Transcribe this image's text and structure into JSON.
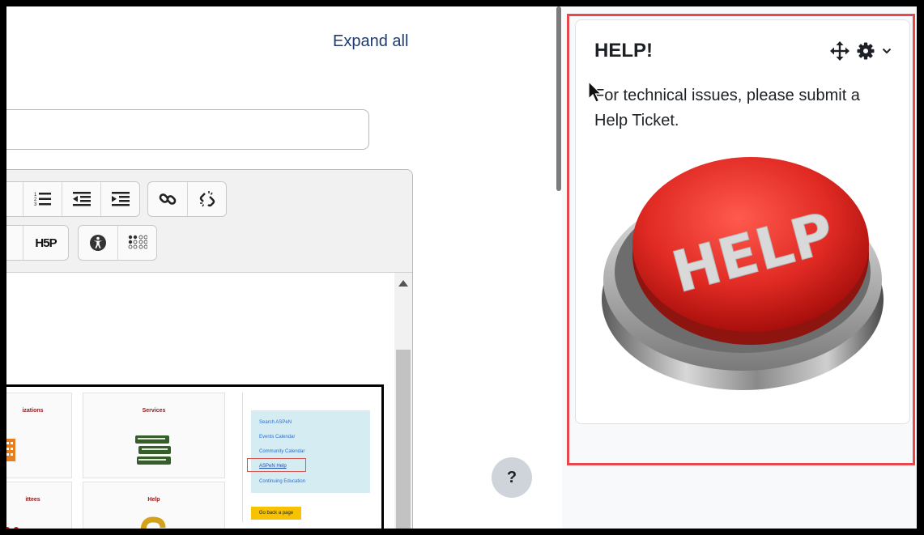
{
  "left_pane": {
    "expand_all": "Expand all",
    "embedded_screenshot": {
      "cards": [
        "izations",
        "Services",
        "ittees",
        "Help"
      ],
      "links": [
        "Search ASPeN",
        "Events Calendar",
        "Community Calendar",
        "ASPeN Help",
        "Continuing Education"
      ],
      "go_back": "Go back a page"
    },
    "toolbar": {
      "h5p_label": "H5P"
    },
    "help_fab": "?"
  },
  "help_block": {
    "title": "HELP!",
    "text": "For technical issues, please submit a Help Ticket.",
    "image_text": "HELP",
    "controls": [
      "move-icon",
      "gear-icon",
      "chevron-down-icon"
    ]
  },
  "colors": {
    "highlight_outline": "#e8474b",
    "link_blue": "#1f3b6e",
    "button_red": "#e02a23"
  }
}
